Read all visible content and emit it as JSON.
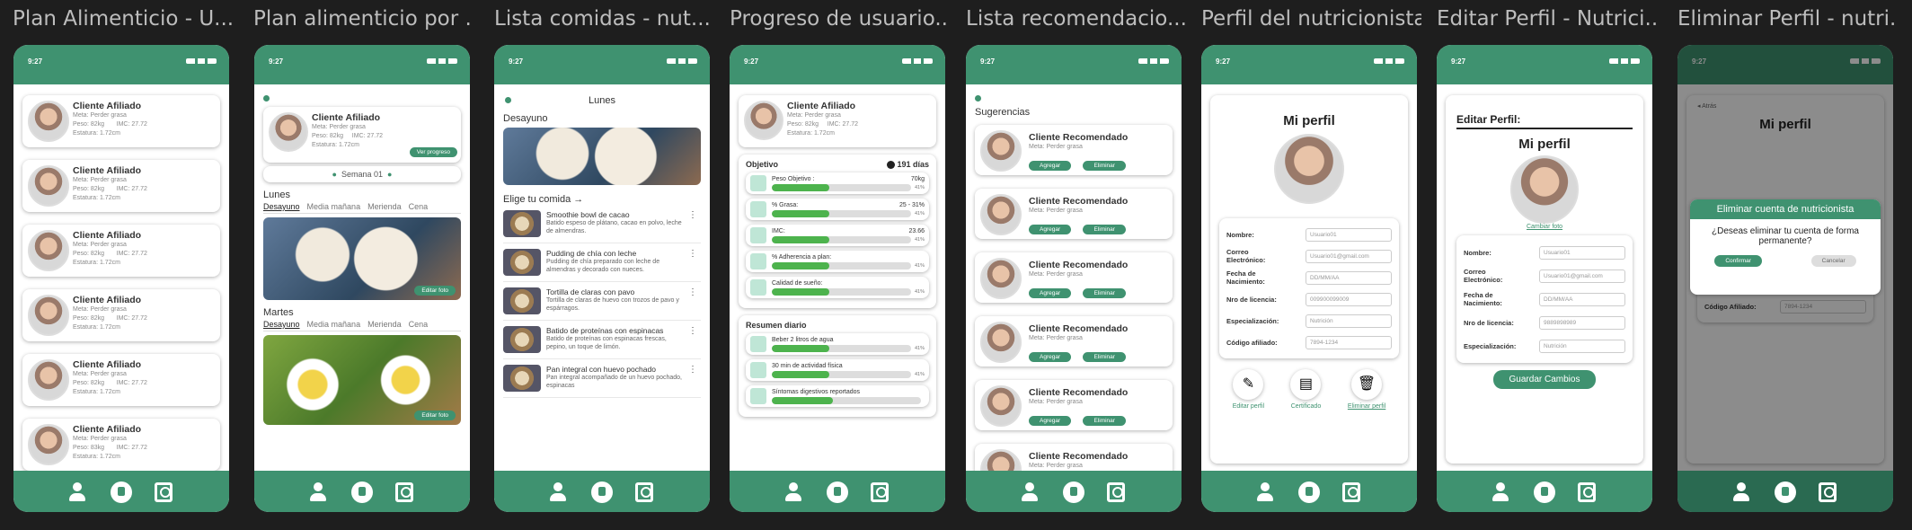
{
  "frames": [
    "Plan Alimenticio - U...",
    "Plan alimenticio por ...",
    "Lista  comidas - nut...",
    "Progreso de usuario...",
    "Lista recomendacio...",
    "Perfil del nutricionista",
    "Editar Perfil - Nutrici...",
    "Eliminar Perfil - nutri..."
  ],
  "time": "9:27",
  "client": {
    "name": "Cliente Afiliado",
    "goal": "Meta: Perder grasa",
    "weight": "Peso: 82kg",
    "weight2": "Peso: 83kg",
    "imc": "IMC: 27.72",
    "height": "Estatura: 1.72cm"
  },
  "plan": {
    "progress_btn": "Ver progreso",
    "week": "Semana 01",
    "day1": "Lunes",
    "day2": "Martes",
    "edit_photo": "Editar foto",
    "tabs": [
      "Desayuno",
      "Media mañana",
      "Merienda",
      "Cena"
    ]
  },
  "foods": {
    "day": "Lunes",
    "meal": "Desayuno",
    "choose": "Elige tu comida",
    "items": [
      {
        "t": "Smoothie bowl de cacao",
        "d": "Batido espeso de plátano, cacao en polvo, leche de almendras."
      },
      {
        "t": "Pudding de chía con leche",
        "d": "Pudding de chía preparado con leche de almendras y decorado con nueces."
      },
      {
        "t": "Tortilla de claras con pavo",
        "d": "Tortilla de claras de huevo con trozos de pavo y espárragos."
      },
      {
        "t": "Batido de proteínas con espinacas",
        "d": "Batido de proteínas con espinacas frescas, pepino, un toque de limón."
      },
      {
        "t": "Pan integral con huevo pochado",
        "d": "Pan integral acompañado de un huevo pochado, espinacas"
      }
    ]
  },
  "progress": {
    "objective": "Objetivo",
    "days": "191 días",
    "rows": [
      {
        "l": "Peso Objetivo :",
        "v": "70kg",
        "p": "41%",
        "f": 0.41
      },
      {
        "l": "% Grasa:",
        "v": "25 - 31%",
        "p": "41%",
        "f": 0.41
      },
      {
        "l": "IMC:",
        "v": "23.66",
        "p": "41%",
        "f": 0.41
      },
      {
        "l": "% Adherencia a plan:",
        "v": "",
        "p": "41%",
        "f": 0.41
      },
      {
        "l": "Calidad de sueño:",
        "v": "",
        "p": "41%",
        "f": 0.41
      }
    ],
    "summary": "Resumen diario",
    "daily": [
      {
        "l": "Beber 2 litros de agua",
        "p": "41%",
        "f": 0.41
      },
      {
        "l": "30 min de actividad física",
        "p": "41%",
        "f": 0.41
      },
      {
        "l": "Síntomas digestivos reportados",
        "p": "",
        "f": 0.41
      }
    ]
  },
  "reco": {
    "title": "Sugerencias",
    "name": "Cliente Recomendado",
    "goal": "Meta: Perder grasa",
    "add": "Agregar",
    "del": "Eliminar"
  },
  "profile": {
    "title": "Mi perfil",
    "fields": [
      {
        "l": "Nombre:",
        "v": "Usuario01"
      },
      {
        "l": "Correo Electrónico:",
        "v": "Usuario01@gmail.com"
      },
      {
        "l": "Fecha de Nacimiento:",
        "v": "DD/MM/AA"
      },
      {
        "l": "Nro de licencia:",
        "v": "009900099009"
      },
      {
        "l": "Especialización:",
        "v": "Nutrición"
      },
      {
        "l": "Código afiliado:",
        "v": "7894-1234"
      }
    ],
    "edit": "Editar perfil",
    "cert": "Certificado",
    "del": "Eliminar perfil"
  },
  "editp": {
    "title": "Editar Perfil:",
    "sub": "Mi perfil",
    "change": "Cambiar foto",
    "fields": [
      {
        "l": "Nombre:",
        "v": "Usuario01"
      },
      {
        "l": "Correo Electrónico:",
        "v": "Usuario01@gmail.com"
      },
      {
        "l": "Fecha de Nacimiento:",
        "v": "DD/MM/AA"
      },
      {
        "l": "Nro de licencia:",
        "v": "9889898989"
      },
      {
        "l": "Especialización:",
        "v": "Nutrición"
      }
    ],
    "save": "Guardar Cambios"
  },
  "delp": {
    "back": "Atrás",
    "sub": "Mi perfil",
    "title": "Eliminar cuenta de nutricionista",
    "q": "¿Deseas eliminar tu cuenta de forma permanente?",
    "ok": "Confirmar",
    "cancel": "Cancelar",
    "fields": [
      {
        "l": "Nombre:",
        "v": "Usuario01"
      },
      {
        "l": "Correo Electrónico:",
        "v": "Usuario01@gmail.com"
      },
      {
        "l": "Fecha de Nacimiento:",
        "v": "DD/MM/AA"
      },
      {
        "l": "Código Afiliado:",
        "v": "7894-1234"
      }
    ]
  }
}
